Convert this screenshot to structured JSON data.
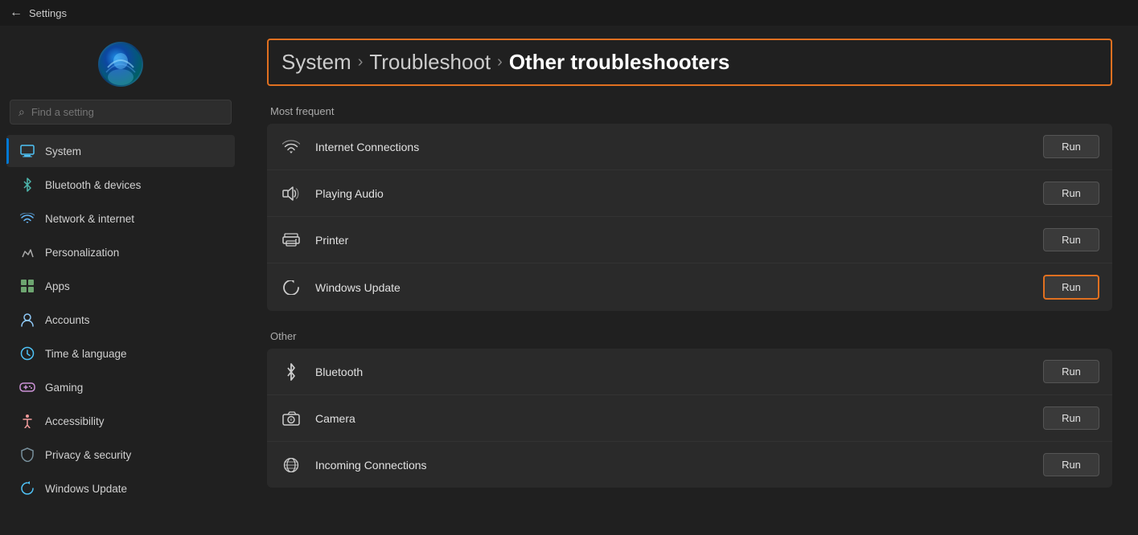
{
  "titlebar": {
    "title": "Settings"
  },
  "sidebar": {
    "search_placeholder": "Find a setting",
    "search_icon": "🔍",
    "nav_items": [
      {
        "id": "system",
        "label": "System",
        "icon": "system",
        "active": true
      },
      {
        "id": "bluetooth",
        "label": "Bluetooth & devices",
        "icon": "bluetooth",
        "active": false
      },
      {
        "id": "network",
        "label": "Network & internet",
        "icon": "network",
        "active": false
      },
      {
        "id": "personalization",
        "label": "Personalization",
        "icon": "personalization",
        "active": false
      },
      {
        "id": "apps",
        "label": "Apps",
        "icon": "apps",
        "active": false
      },
      {
        "id": "accounts",
        "label": "Accounts",
        "icon": "accounts",
        "active": false
      },
      {
        "id": "time",
        "label": "Time & language",
        "icon": "time",
        "active": false
      },
      {
        "id": "gaming",
        "label": "Gaming",
        "icon": "gaming",
        "active": false
      },
      {
        "id": "accessibility",
        "label": "Accessibility",
        "icon": "accessibility",
        "active": false
      },
      {
        "id": "privacy",
        "label": "Privacy & security",
        "icon": "privacy",
        "active": false
      },
      {
        "id": "update",
        "label": "Windows Update",
        "icon": "update",
        "active": false
      }
    ]
  },
  "content": {
    "breadcrumb": {
      "part1": "System",
      "separator1": ">",
      "part2": "Troubleshoot",
      "separator2": ">",
      "part3": "Other troubleshooters"
    },
    "most_frequent_label": "Most frequent",
    "most_frequent": [
      {
        "id": "internet",
        "name": "Internet Connections",
        "icon": "wifi",
        "run_label": "Run",
        "highlighted": false
      },
      {
        "id": "audio",
        "name": "Playing Audio",
        "icon": "audio",
        "run_label": "Run",
        "highlighted": false
      },
      {
        "id": "printer",
        "name": "Printer",
        "icon": "printer",
        "run_label": "Run",
        "highlighted": false
      },
      {
        "id": "winupdate",
        "name": "Windows Update",
        "icon": "update",
        "run_label": "Run",
        "highlighted": true
      }
    ],
    "other_label": "Other",
    "other": [
      {
        "id": "bluetooth",
        "name": "Bluetooth",
        "icon": "bluetooth",
        "run_label": "Run",
        "highlighted": false
      },
      {
        "id": "camera",
        "name": "Camera",
        "icon": "camera",
        "run_label": "Run",
        "highlighted": false
      },
      {
        "id": "incoming",
        "name": "Incoming Connections",
        "icon": "incoming",
        "run_label": "Run",
        "highlighted": false
      }
    ]
  }
}
